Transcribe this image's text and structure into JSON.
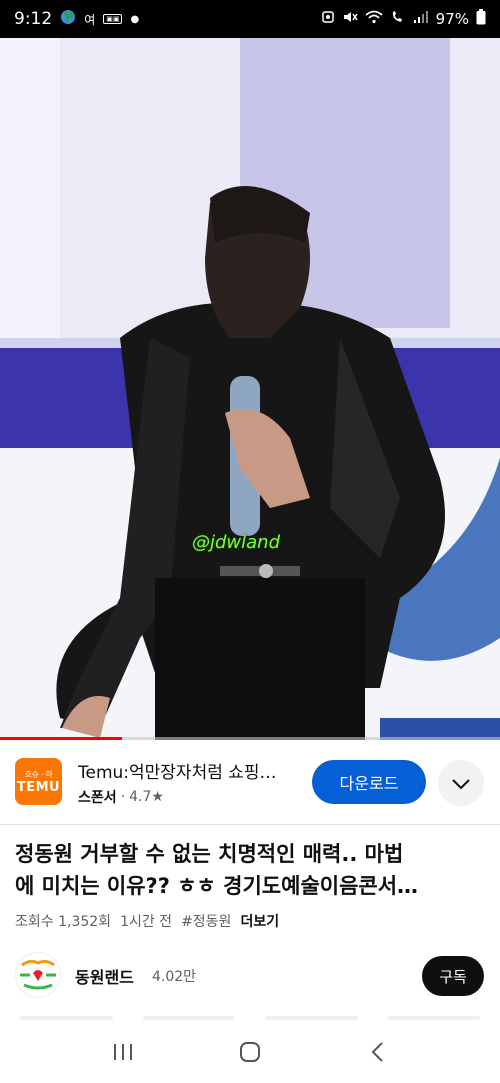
{
  "status_bar": {
    "time": "9:12",
    "carrier_badge": "여",
    "battery": "97%"
  },
  "video": {
    "watermark": "@jdwland",
    "progress_fraction": 0.244,
    "colors": {
      "progress": "#ff0000"
    }
  },
  "ad": {
    "logo_small": "흐슈ㆍ하",
    "logo_text": "TEMU",
    "title": "Temu:억만장자처럼 쇼핑하기",
    "sponsor_label": "스폰서",
    "separator": "·",
    "rating": "4.7★",
    "download_label": "다운로드",
    "colors": {
      "logo_bg": "#fb7701",
      "download_bg": "#065fd4"
    }
  },
  "details": {
    "title_line1": "정동원 거부할 수 없는 치명적인 매력.. 마법",
    "title_line2": "에 미치는 이유?? ㅎㅎ 경기도예술이음콘서…",
    "views": "조회수 1,352회",
    "time_ago": "1시간 전",
    "hashtag": "#정동원",
    "more": "더보기"
  },
  "channel": {
    "name": "동원랜드",
    "subscribers": "4.02만",
    "subscribe_label": "구독",
    "avatar_text": "내 영랜드"
  },
  "nav": {
    "icons": [
      "recent-apps-icon",
      "home-icon",
      "back-icon"
    ]
  }
}
